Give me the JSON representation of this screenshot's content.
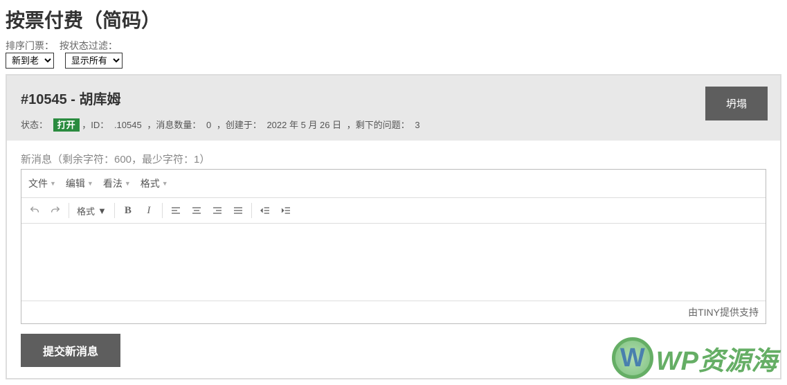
{
  "page_title": "按票付费（简码）",
  "filters": {
    "sort_label": "排序门票：",
    "sort_value": "新到老",
    "status_label": "按状态过滤：",
    "status_value": "显示所有"
  },
  "ticket": {
    "header_title": "#10545 - 胡库姆",
    "collapse_label": "坍塌",
    "meta": {
      "status_label": "状态：",
      "status_badge": "打开",
      "id_label": "，ID：",
      "id_value": ".10545",
      "msg_count_label": "，消息数量：",
      "msg_count_value": "0",
      "created_label": "，创建于：",
      "created_value": "2022 年 5 月 26 日",
      "remaining_label": "，剩下的问题：",
      "remaining_value": "3"
    }
  },
  "editor": {
    "hint": "新消息（剩余字符：600，最少字符：1）",
    "menus": {
      "file": "文件",
      "edit": "编辑",
      "view": "看法",
      "format": "格式"
    },
    "format_select": "格式",
    "statusbar": "由TINY提供支持",
    "content": ""
  },
  "submit_label": "提交新消息",
  "watermark": "WP资源海"
}
